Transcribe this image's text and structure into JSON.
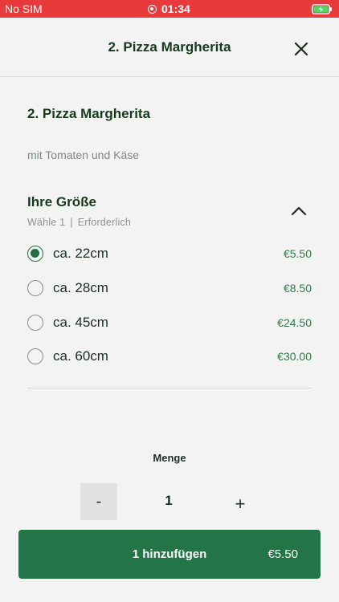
{
  "status_bar": {
    "carrier": "No SIM",
    "time": "01:34"
  },
  "header": {
    "title": "2. Pizza Margherita"
  },
  "product": {
    "title": "2. Pizza Margherita",
    "description": "mit Tomaten und Käse"
  },
  "size_section": {
    "title": "Ihre Größe",
    "choose": "Wähle 1",
    "separator": "|",
    "required": "Erforderlich",
    "options": [
      {
        "label": "ca. 22cm",
        "price": "€5.50",
        "selected": true
      },
      {
        "label": "ca. 28cm",
        "price": "€8.50",
        "selected": false
      },
      {
        "label": "ca. 45cm",
        "price": "€24.50",
        "selected": false
      },
      {
        "label": "ca. 60cm",
        "price": "€30.00",
        "selected": false
      }
    ]
  },
  "quantity": {
    "label": "Menge",
    "minus": "-",
    "value": "1",
    "plus": "+"
  },
  "add_button": {
    "label": "1 hinzufügen",
    "price": "€5.50"
  },
  "colors": {
    "status_bar": "#e8393b",
    "accent": "#237548",
    "background": "#f3f3f3"
  }
}
